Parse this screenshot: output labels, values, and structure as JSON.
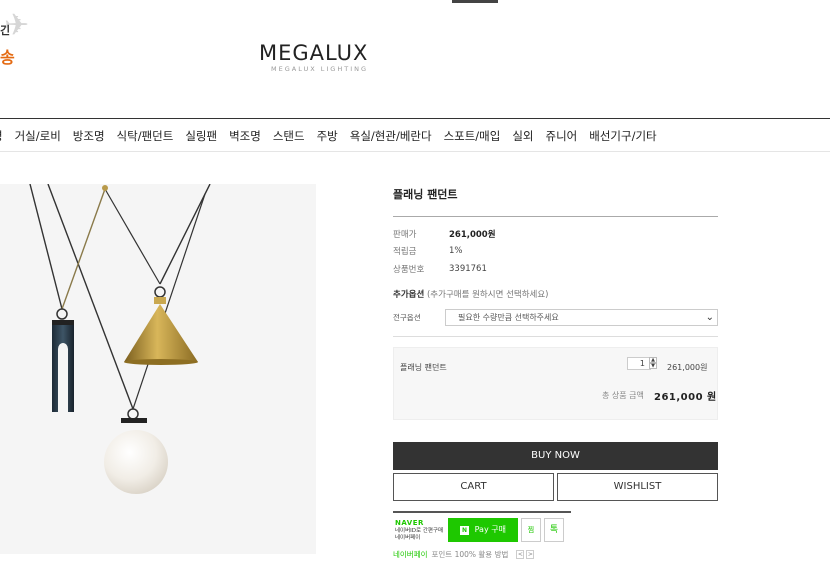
{
  "promo": {
    "line1": "긴",
    "line2": "송"
  },
  "logo": {
    "main": "MEGALUX",
    "sub": "MEGALUX LIGHTING"
  },
  "gnb": {
    "items": [
      "명",
      "거실/로비",
      "방조명",
      "식탁/팬던트",
      "실링팬",
      "벽조명",
      "스탠드",
      "주방",
      "욕실/현관/베란다",
      "스포트/매입",
      "실외",
      "쥬니어",
      "배선기구/기타"
    ]
  },
  "product": {
    "title": "플래닝 팬던트",
    "price_label": "판매가",
    "price": "261,000원",
    "point_label": "적립금",
    "point": "1%",
    "code_label": "상품번호",
    "code": "3391761",
    "option_title": "추가옵션",
    "option_hint": "(추가구매를 원하시면 선택하세요)",
    "option_label": "전구옵션",
    "option_placeholder": "필요한 수량만큼 선택하주세요",
    "selected_name": "플래닝 팬던트",
    "quantity": "1",
    "item_price": "261,000원",
    "total_label": "총 상품 금액",
    "total_price": "261,000 원"
  },
  "buttons": {
    "buy": "BUY NOW",
    "cart": "CART",
    "wishlist": "WISHLIST"
  },
  "npay": {
    "brand": "NAVER",
    "desc1": "네이버ID로 간편구매",
    "desc2": "네이버페이",
    "pay_label": "Pay 구매",
    "pay_n": "N",
    "zzim": "찜",
    "talk": "톡",
    "foot_brand": "네이버페이",
    "foot_rest": "포인트 100% 활용 방법",
    "foot_prev": "<",
    "foot_next": ">"
  }
}
